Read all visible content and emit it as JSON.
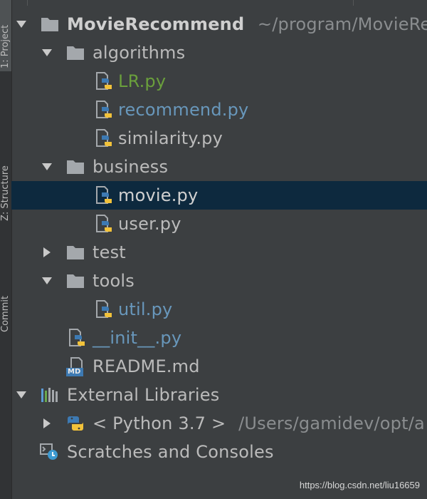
{
  "sidebar": {
    "tabs": [
      {
        "label": "1: Project",
        "active": true
      },
      {
        "label": "Z: Structure",
        "active": false
      },
      {
        "label": "Commit",
        "active": false
      }
    ]
  },
  "tree": {
    "root": {
      "name": "MovieRecommend",
      "path": "~/program/MovieRe"
    },
    "algorithms": {
      "name": "algorithms",
      "files": [
        "LR.py",
        "recommend.py",
        "similarity.py"
      ]
    },
    "business": {
      "name": "business",
      "files": [
        "movie.py",
        "user.py"
      ]
    },
    "test": {
      "name": "test"
    },
    "tools": {
      "name": "tools",
      "files": [
        "util.py"
      ]
    },
    "init_file": "__init__.py",
    "readme": "README.md",
    "readme_badge": "MD",
    "external_libraries": {
      "name": "External Libraries",
      "sdk_name": "< Python 3.7 >",
      "sdk_path": "/Users/gamidev/opt/a"
    },
    "scratches": "Scratches and Consoles"
  },
  "watermark": "https://blog.csdn.net/liu16659",
  "colors": {
    "background": "#3c3f41",
    "selected_row": "#0d293e",
    "vcs_added": "#6a9f3c",
    "vcs_modified": "#6897bb",
    "text": "#bbbbbb"
  }
}
